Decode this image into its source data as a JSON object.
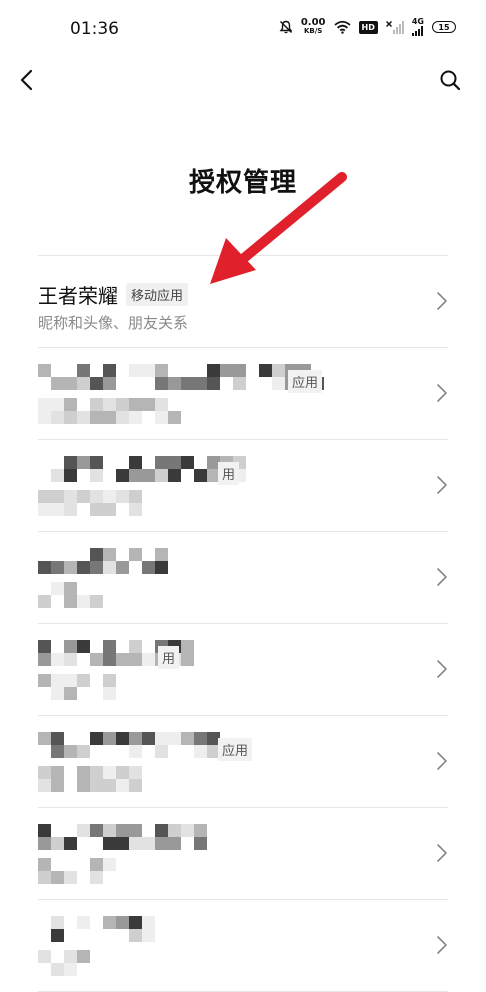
{
  "status_bar": {
    "time": "01:36",
    "net_speed": "0.00",
    "net_unit": "KB/S",
    "hd_label": "HD",
    "network_type": "4G",
    "battery": "15"
  },
  "page": {
    "title": "授权管理"
  },
  "apps": [
    {
      "name": "王者荣耀",
      "tag": "移动应用",
      "desc": "昵称和头像、朋友关系"
    }
  ],
  "blurred_rows": [
    {
      "visible_text": "应用"
    },
    {
      "visible_text": "用"
    },
    {
      "visible_text": ""
    },
    {
      "visible_text": "用"
    },
    {
      "visible_text": "应用"
    },
    {
      "visible_text": ""
    },
    {
      "visible_text": ""
    }
  ],
  "annotation": {
    "arrow_color": "#e0202a"
  }
}
